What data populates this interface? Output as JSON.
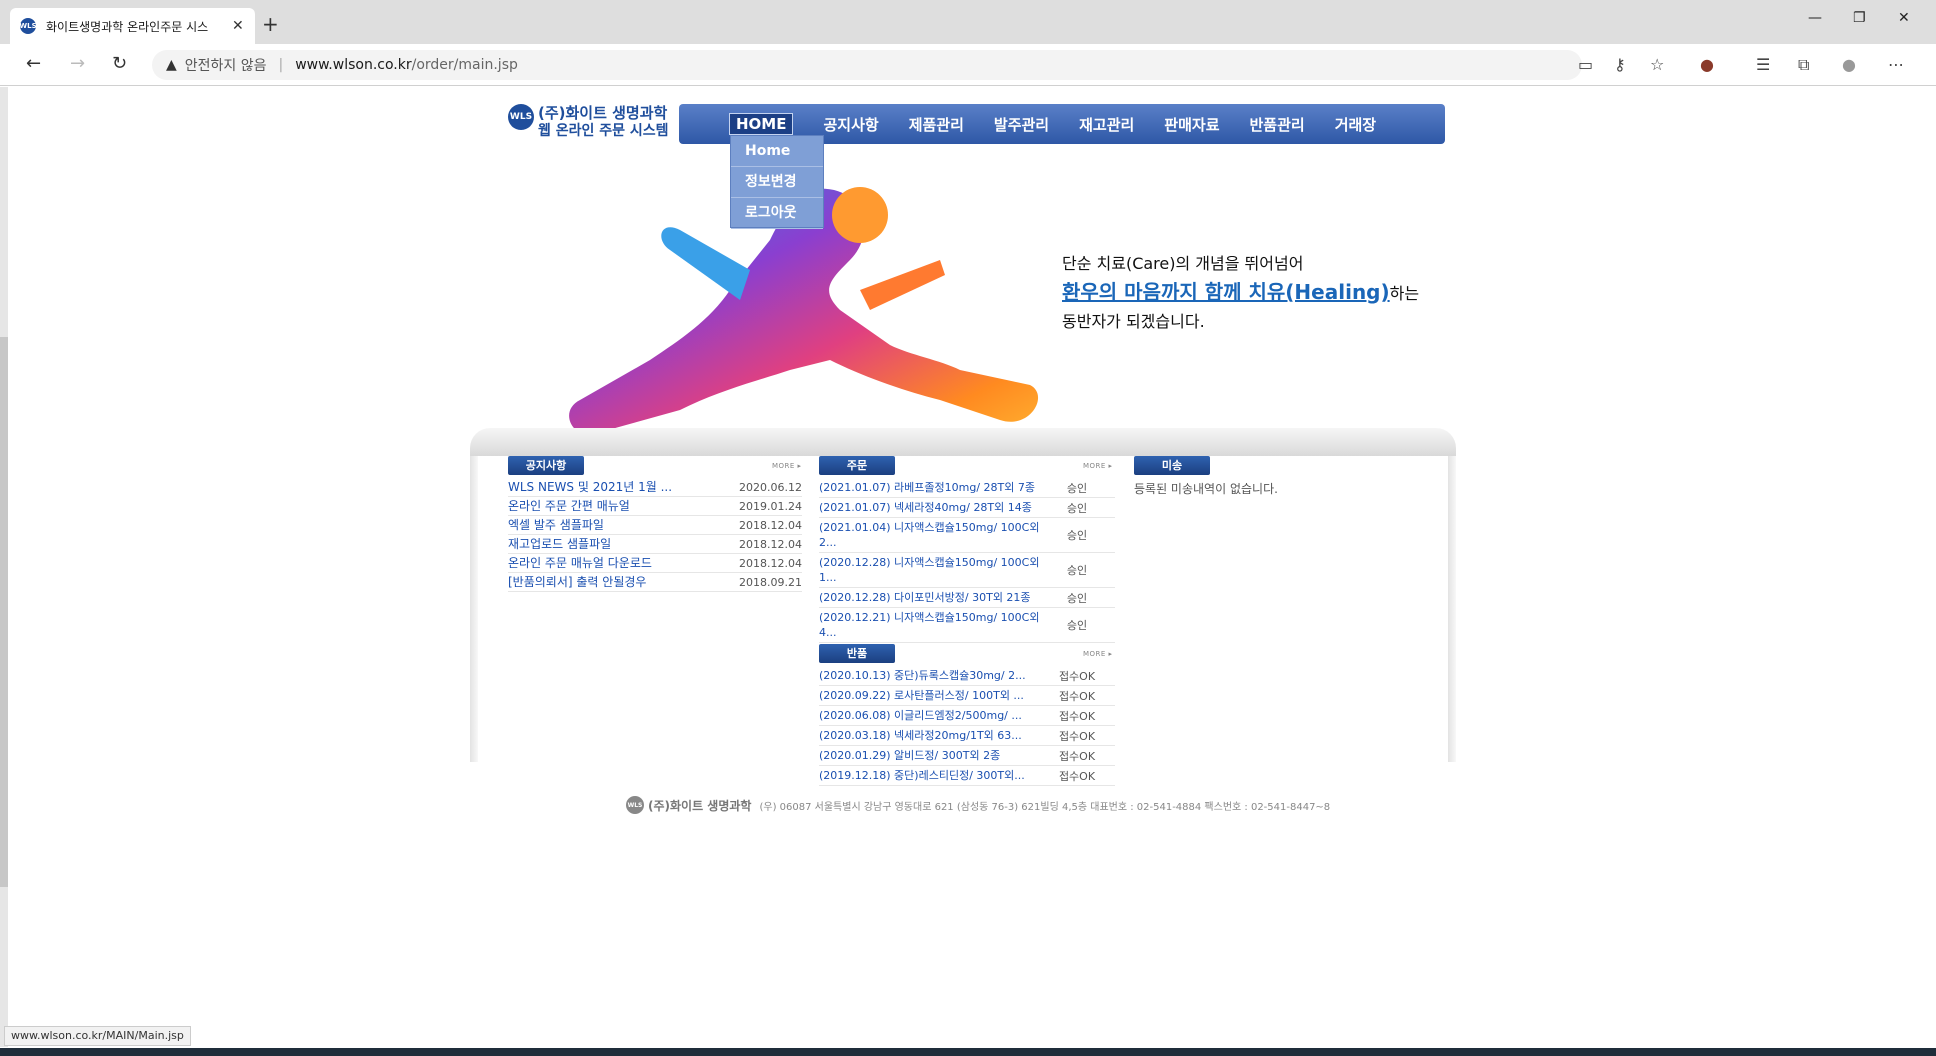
{
  "browser": {
    "tab_title": "화이트생명과학 온라인주문 시스",
    "url_warning": "안전하지 않음",
    "url_host": "www.wlson.co.kr",
    "url_path": "/order/main.jsp",
    "status_url": "www.wlson.co.kr/MAIN/Main.jsp"
  },
  "logo": {
    "mark": "WLS",
    "line1": "(주)화이트 생명과학",
    "line2": "웹 온라인 주문 시스템"
  },
  "nav": {
    "items": [
      "HOME",
      "공지사항",
      "제품관리",
      "발주관리",
      "재고관리",
      "판매자료",
      "반품관리",
      "거래장"
    ],
    "dropdown": [
      "Home",
      "정보변경",
      "로그아웃"
    ]
  },
  "hero": {
    "line1": "단순 치료(Care)의 개념을 뛰어넘어",
    "highlight": "환우의 마음까지 함께 치유(Healing)",
    "line2_suffix": "하는",
    "line3": "동반자가 되겠습니다."
  },
  "notice": {
    "title": "공지사항",
    "more": "MORE ▸",
    "rows": [
      {
        "text": "WLS NEWS 및 2021년 1월 ...",
        "date": "2020.06.12"
      },
      {
        "text": "온라인 주문 간편 매뉴얼",
        "date": "2019.01.24"
      },
      {
        "text": "엑셀 발주 샘플파일",
        "date": "2018.12.04"
      },
      {
        "text": "재고업로드 샘플파일",
        "date": "2018.12.04"
      },
      {
        "text": "온라인 주문 매뉴얼 다운로드",
        "date": "2018.12.04"
      },
      {
        "text": "[반품의뢰서] 출력 안될경우",
        "date": "2018.09.21"
      }
    ]
  },
  "orders": {
    "title": "주문",
    "more": "MORE ▸",
    "rows": [
      {
        "text": "(2021.01.07) 라베프졸정10mg/ 28T외 7종",
        "status": "승인"
      },
      {
        "text": "(2021.01.07) 넥세라정40mg/ 28T외 14종",
        "status": "승인"
      },
      {
        "text": "(2021.01.04) 니자액스캡슐150mg/ 100C외 2...",
        "status": "승인"
      },
      {
        "text": "(2020.12.28) 니자액스캡슐150mg/ 100C외 1...",
        "status": "승인"
      },
      {
        "text": "(2020.12.28) 다이포민서방정/ 30T외 21종",
        "status": "승인"
      },
      {
        "text": "(2020.12.21) 니자액스캡슐150mg/ 100C외 4...",
        "status": "승인"
      }
    ]
  },
  "returns": {
    "title": "반품",
    "more": "MORE ▸",
    "rows": [
      {
        "text": "(2020.10.13) 중단)듀록스캡슐30mg/ 2...",
        "status": "접수OK"
      },
      {
        "text": "(2020.09.22) 로사탄플러스정/ 100T외 ...",
        "status": "접수OK"
      },
      {
        "text": "(2020.06.08) 이글리드엠정2/500mg/ ...",
        "status": "접수OK"
      },
      {
        "text": "(2020.03.18) 넥세라정20mg/1T외 63...",
        "status": "접수OK"
      },
      {
        "text": "(2020.01.29) 알비드정/ 300T외 2종",
        "status": "접수OK"
      },
      {
        "text": "(2019.12.18) 중단)레스티딘정/ 300T외...",
        "status": "접수OK"
      }
    ]
  },
  "undelivered": {
    "title": "미송",
    "empty_text": "등록된 미송내역이 없습니다."
  },
  "footer": {
    "name": "(주)화이트 생명과학",
    "address": "(우) 06087 서울특별시 강남구 영동대로 621 (삼성동 76-3) 621빌딩 4,5층   대표번호 : 02-541-4884 팩스번호 : 02-541-8447~8"
  }
}
